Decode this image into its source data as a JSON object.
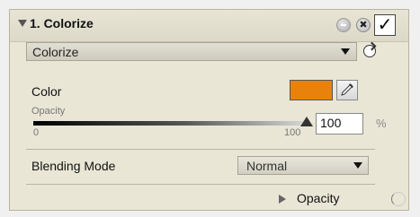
{
  "panel": {
    "title": "1. Colorize",
    "header_buttons": {
      "minimize_icon": "circle-minus-icon",
      "close_icon": "close-icon",
      "close_glyph": "✖",
      "enable_check_glyph": "✓",
      "enabled": true
    }
  },
  "method_select": {
    "value": "Colorize",
    "icon": "chevron-down-icon",
    "reset_icon": "refresh-icon"
  },
  "color": {
    "label": "Color",
    "swatch_color": "#e8820c",
    "picker_icon": "eyedropper-icon"
  },
  "opacity": {
    "label": "Opacity",
    "min_label": "0",
    "max_label": "100",
    "value": "100",
    "value_fraction": 1.0,
    "unit": "%"
  },
  "blending": {
    "label": "Blending Mode",
    "value": "Normal"
  },
  "footer": {
    "label": "Opacity"
  },
  "colors": {
    "panel_bg": "#e9e6d6",
    "accent_orange": "#e8820c"
  }
}
